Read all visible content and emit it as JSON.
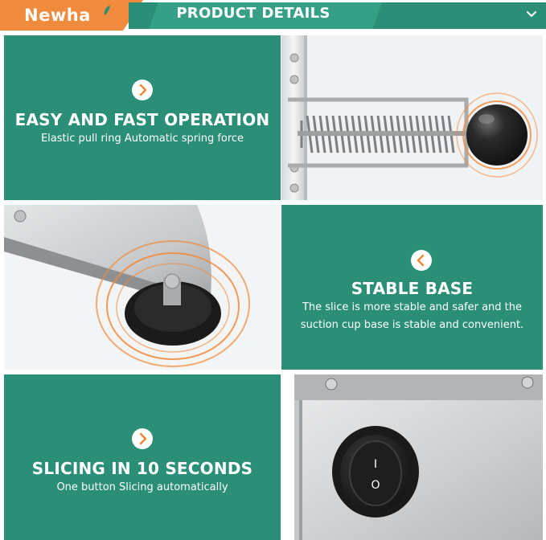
{
  "header": {
    "brand": "Newha",
    "title": "PRODUCT DETAILS"
  },
  "features": [
    {
      "headline": "EASY AND FAST OPERATION",
      "description": "Elastic pull ring Automatic spring force",
      "icon": "chevron-right-icon"
    },
    {
      "headline": "STABLE BASE",
      "description_line1": "The slice is more stable and safer and the",
      "description_line2": "suction cup base is stable and convenient.",
      "icon": "chevron-left-icon"
    },
    {
      "headline": "SLICING IN 10 SECONDS",
      "description": "One button  Slicing automatically",
      "icon": "chevron-right-icon"
    }
  ],
  "colors": {
    "panel_green": "#2a8f76",
    "accent_orange": "#f08a3c",
    "white": "#ffffff"
  },
  "switch": {
    "on_symbol": "I",
    "off_symbol": "O"
  }
}
